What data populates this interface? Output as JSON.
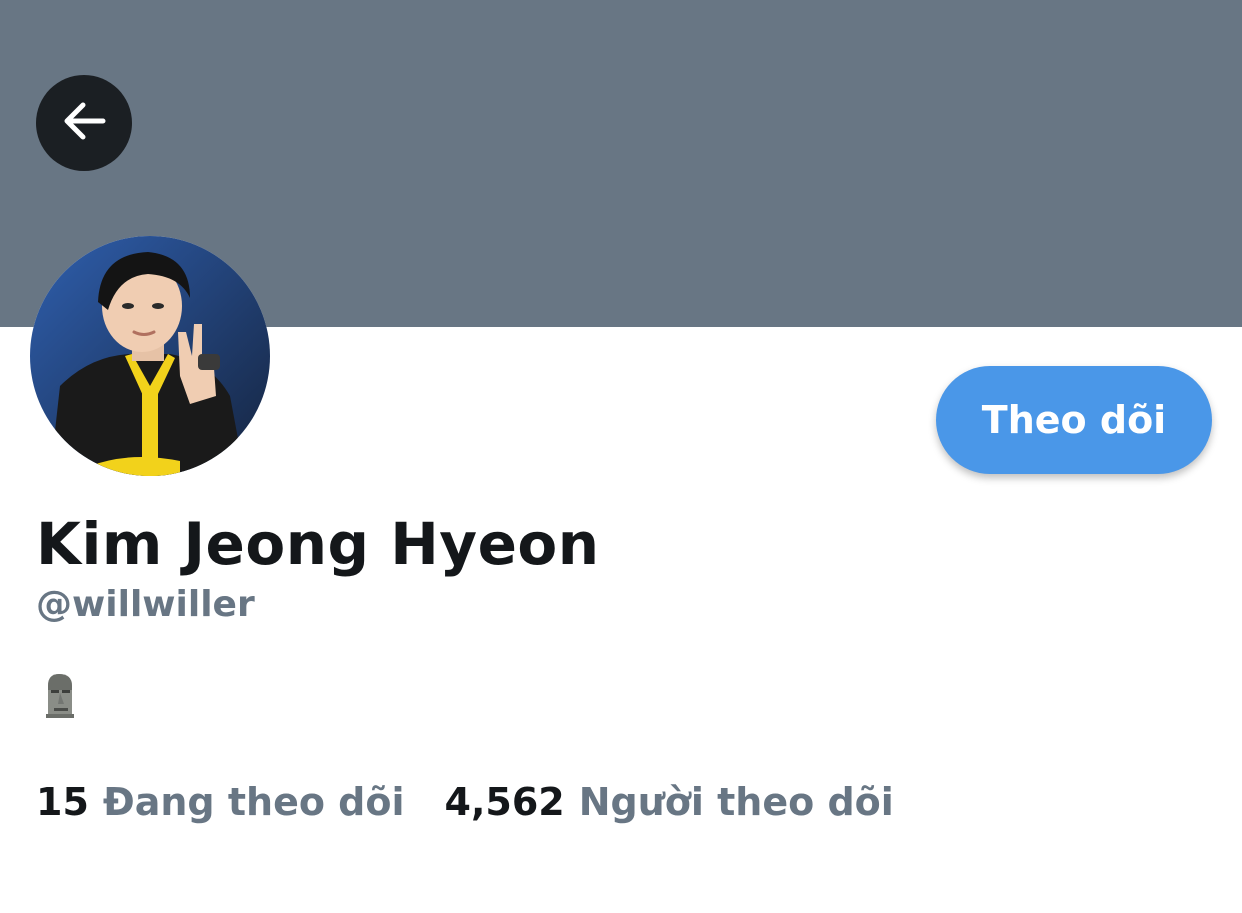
{
  "header": {
    "back_icon": "arrow-left-icon",
    "banner_color": "#687684"
  },
  "profile": {
    "display_name": "Kim Jeong Hyeon",
    "handle": "@willwiller",
    "bio_emoji": "moai-emoji",
    "follow_button_label": "Theo dõi",
    "follow_button_color": "#4a97e8"
  },
  "stats": {
    "following_count": "15",
    "following_label": "Đang theo dõi",
    "followers_count": "4,562",
    "followers_label": "Người theo dõi"
  }
}
